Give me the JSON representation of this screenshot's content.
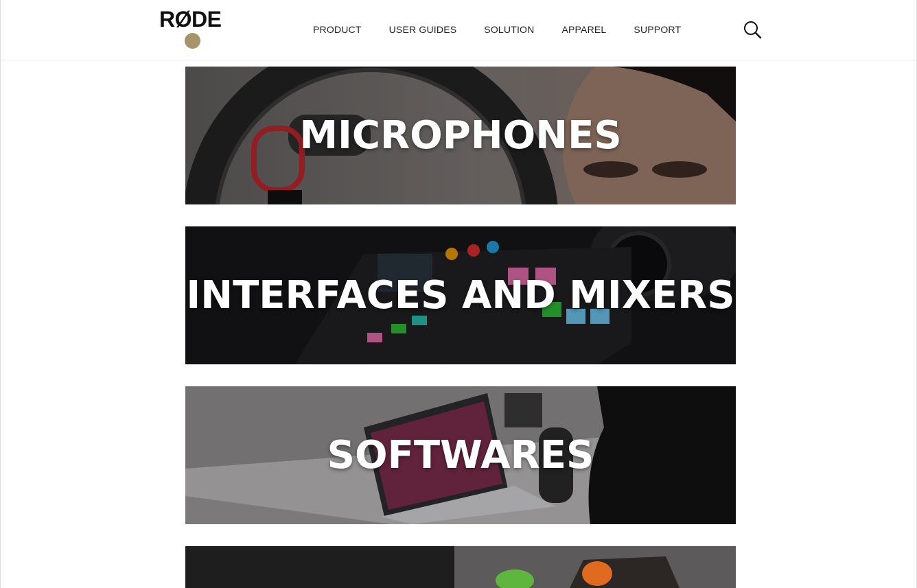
{
  "brand": {
    "logo_text": "RØDE",
    "accent_color": "#a8946b"
  },
  "nav": {
    "items": [
      {
        "label": "PRODUCT"
      },
      {
        "label": "USER GUIDES"
      },
      {
        "label": "SOLUTION"
      },
      {
        "label": "APPAREL"
      },
      {
        "label": "SUPPORT"
      }
    ],
    "search_icon": "search-icon"
  },
  "categories": [
    {
      "title": "MICROPHONES"
    },
    {
      "title": "INTERFACES AND MIXERS"
    },
    {
      "title": "SOFTWARES"
    },
    {
      "title": ""
    }
  ]
}
